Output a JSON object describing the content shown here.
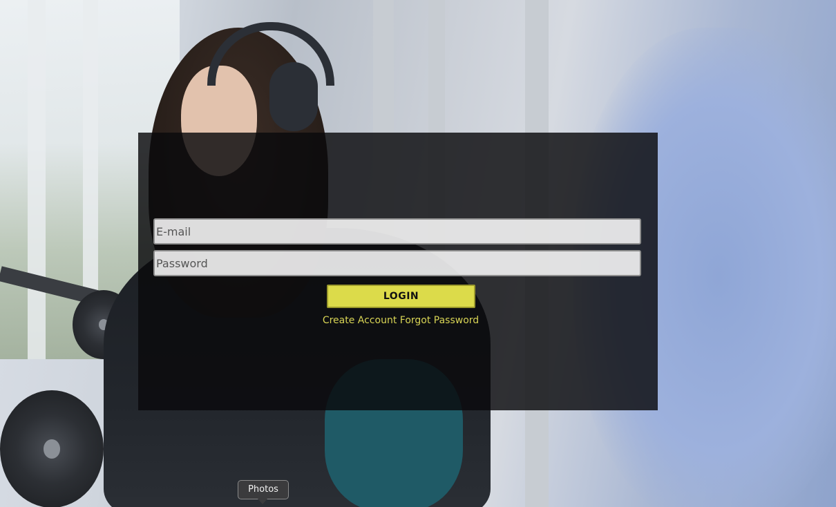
{
  "login_form": {
    "email_placeholder": "E-mail",
    "password_placeholder": "Password",
    "login_label": "LOGIN",
    "create_account_label": "Create Account",
    "forgot_password_label": "Forgot Password"
  },
  "tooltip": {
    "label": "Photos"
  },
  "colors": {
    "accent": "#dcdb4a",
    "link": "#d8d455",
    "panel_bg": "#0a0a0c"
  }
}
